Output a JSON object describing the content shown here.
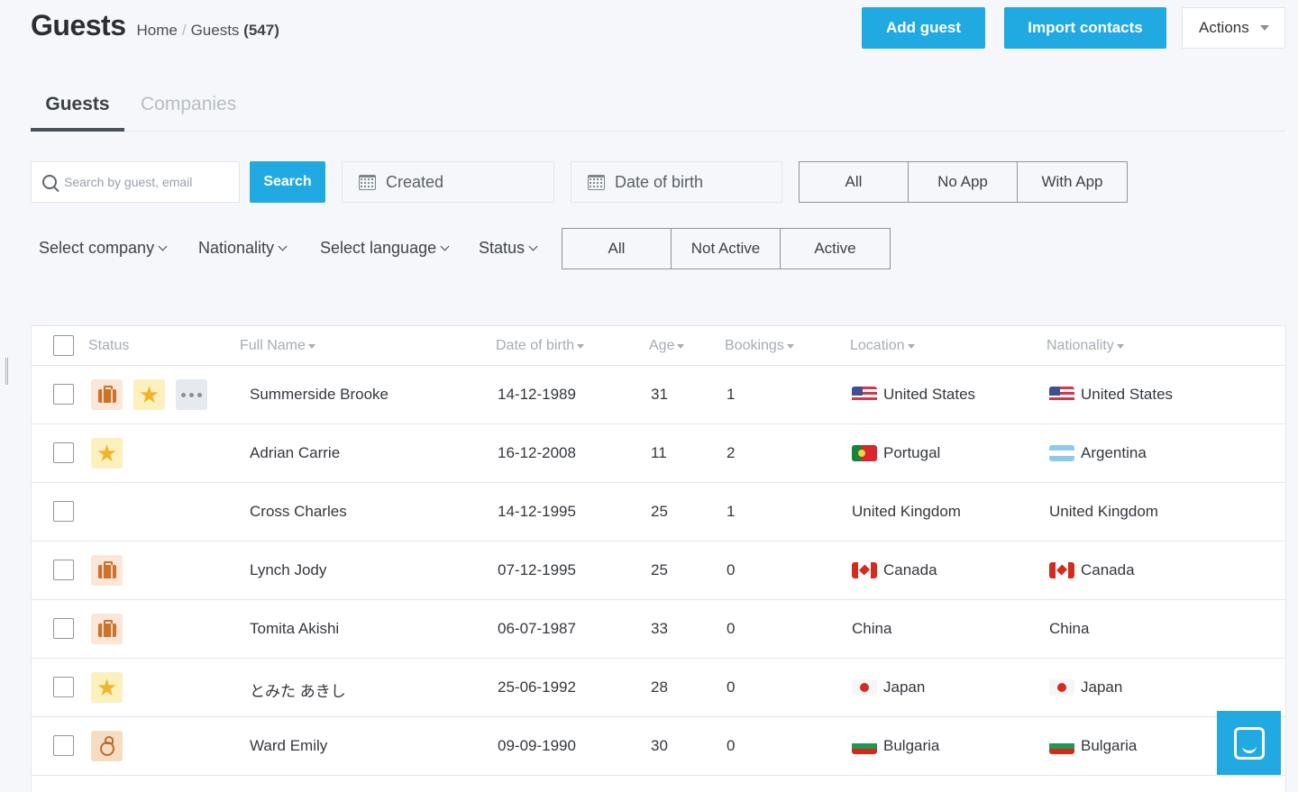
{
  "header": {
    "title": "Guests",
    "breadcrumb": {
      "home": "Home",
      "current": "Guests",
      "count": "(547)"
    },
    "add_guest": "Add guest",
    "import_contacts": "Import contacts",
    "actions": "Actions"
  },
  "tabs": [
    {
      "label": "Guests",
      "active": true
    },
    {
      "label": "Companies",
      "active": false
    }
  ],
  "filters": {
    "search_placeholder": "Search by guest, email",
    "search_button": "Search",
    "created": "Created",
    "date_of_birth": "Date of birth",
    "app_segment": [
      "All",
      "No App",
      "With App"
    ],
    "company": "Select company",
    "nationality": "Nationality",
    "language": "Select language",
    "status": "Status",
    "status_segment": [
      "All",
      "Not Active",
      "Active"
    ]
  },
  "table": {
    "columns": {
      "status": "Status",
      "full_name": "Full Name",
      "dob": "Date of birth",
      "age": "Age",
      "bookings": "Bookings",
      "location": "Location",
      "nationality": "Nationality"
    },
    "rows": [
      {
        "badges": [
          "briefcase-icon",
          "star-icon",
          "more-icon"
        ],
        "name": "Summerside Brooke",
        "dob": "14-12-1989",
        "age": "31",
        "bookings": "1",
        "location": "United States",
        "location_flag": "us",
        "nationality": "United States",
        "nationality_flag": "us"
      },
      {
        "badges": [
          "star-icon"
        ],
        "name": "Adrian Carrie",
        "dob": "16-12-2008",
        "age": "11",
        "bookings": "2",
        "location": "Portugal",
        "location_flag": "pt",
        "nationality": "Argentina",
        "nationality_flag": "ar"
      },
      {
        "badges": [],
        "name": "Cross Charles",
        "dob": "14-12-1995",
        "age": "25",
        "bookings": "1",
        "location": "United Kingdom",
        "location_flag": "",
        "nationality": "United Kingdom",
        "nationality_flag": ""
      },
      {
        "badges": [
          "briefcase-icon"
        ],
        "name": "Lynch Jody",
        "dob": "07-12-1995",
        "age": "25",
        "bookings": "0",
        "location": "Canada",
        "location_flag": "ca",
        "nationality": "Canada",
        "nationality_flag": "ca"
      },
      {
        "badges": [
          "briefcase-icon"
        ],
        "name": "Tomita Akishi",
        "dob": "06-07-1987",
        "age": "33",
        "bookings": "0",
        "location": "China",
        "location_flag": "",
        "nationality": "China",
        "nationality_flag": ""
      },
      {
        "badges": [
          "star-icon"
        ],
        "name": "とみた あきし",
        "dob": "25-06-1992",
        "age": "28",
        "bookings": "0",
        "location": "Japan",
        "location_flag": "jp",
        "nationality": "Japan",
        "nationality_flag": "jp"
      },
      {
        "badges": [
          "ring-icon"
        ],
        "name": "Ward Emily",
        "dob": "09-09-1990",
        "age": "30",
        "bookings": "0",
        "location": "Bulgaria",
        "location_flag": "bg",
        "nationality": "Bulgaria",
        "nationality_flag": "bg"
      }
    ]
  },
  "colors": {
    "primary": "#21aae1",
    "star": "#f1b52c",
    "briefcase": "#c9732d"
  }
}
